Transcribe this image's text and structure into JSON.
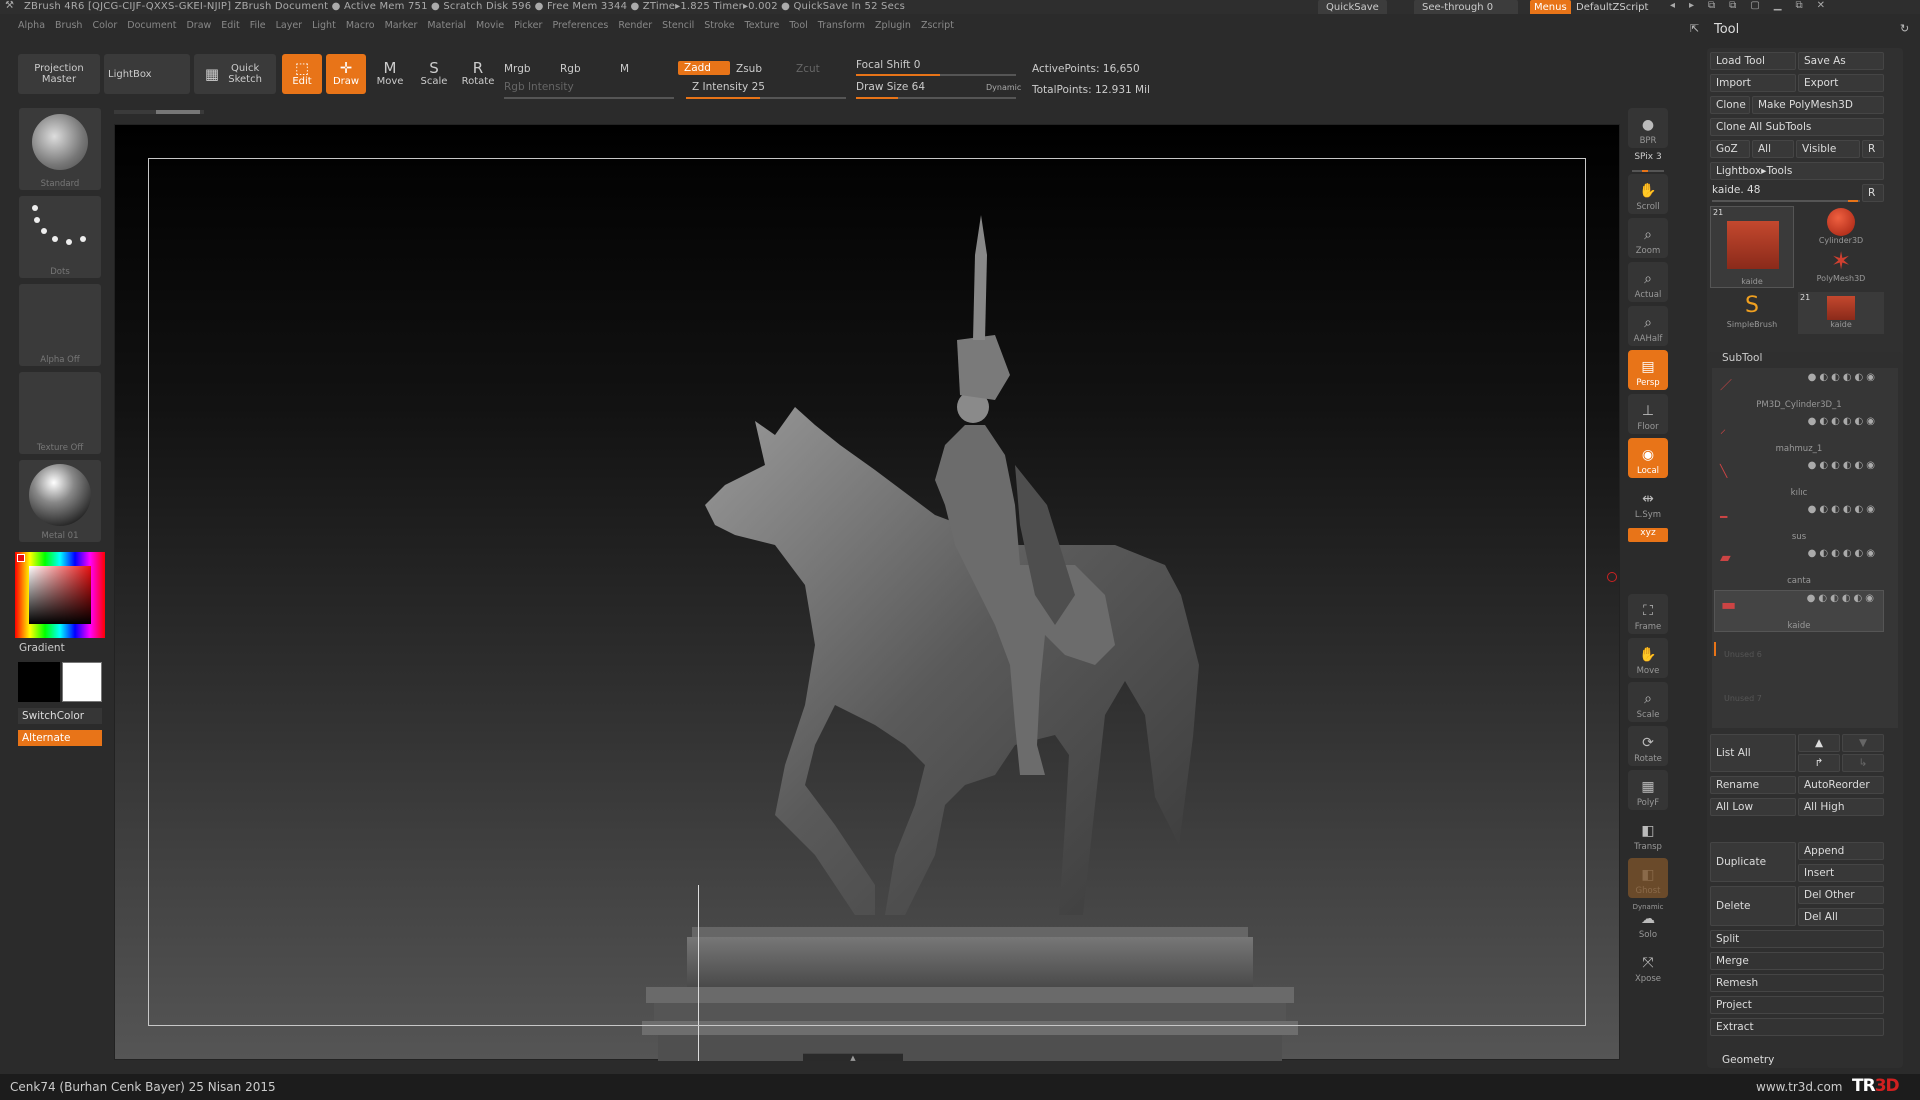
{
  "title": "ZBrush 4R6 [QJCG-CIJF-QXXS-GKEI-NJIP]   ZBrush Document    ● Active Mem 751  ● Scratch Disk 596  ● Free Mem 3344  ● ZTime▸1.825  Timer▸0.002  ● QuickSave In 52 Secs",
  "title_right": {
    "quicksave": "QuickSave",
    "see_through": "See-through  0",
    "menus": "Menus",
    "script": "DefaultZScript"
  },
  "menu": [
    "Alpha",
    "Brush",
    "Color",
    "Document",
    "Draw",
    "Edit",
    "File",
    "Layer",
    "Light",
    "Macro",
    "Marker",
    "Material",
    "Movie",
    "Picker",
    "Preferences",
    "Render",
    "Stencil",
    "Stroke",
    "Texture",
    "Tool",
    "Transform",
    "Zplugin",
    "Zscript"
  ],
  "toolbar": {
    "projection_master": "Projection Master",
    "lightbox": "LightBox",
    "quick_sketch": "Quick Sketch",
    "edit": "Edit",
    "draw": "Draw",
    "move": "Move",
    "scale": "Scale",
    "rotate": "Rotate",
    "mrgb": "Mrgb",
    "rgb": "Rgb",
    "m": "M",
    "rgb_intensity": "Rgb Intensity",
    "zadd": "Zadd",
    "zsub": "Zsub",
    "zcut": "Zcut",
    "z_intensity": "Z Intensity 25",
    "focal_shift": "Focal Shift 0",
    "draw_size": "Draw Size 64",
    "dynamic": "Dynamic",
    "active_points": "ActivePoints: 16,650",
    "total_points": "TotalPoints: 12.931  Mil"
  },
  "left": {
    "brush": "Standard",
    "stroke": "Dots",
    "alpha": "Alpha Off",
    "texture": "Texture Off",
    "material": "Metal 01",
    "gradient": "Gradient",
    "switch_color": "SwitchColor",
    "alternate": "Alternate"
  },
  "right_strip": [
    {
      "label": "BPR"
    },
    {
      "label": "SPix 3"
    },
    {
      "label": "Scroll"
    },
    {
      "label": "Zoom"
    },
    {
      "label": "Actual"
    },
    {
      "label": "AAHalf"
    },
    {
      "label": "Persp"
    },
    {
      "label": "Floor"
    },
    {
      "label": "Local"
    },
    {
      "label": "L.Sym"
    },
    {
      "label": "Frame"
    },
    {
      "label": "Move"
    },
    {
      "label": "Scale"
    },
    {
      "label": "Rotate"
    },
    {
      "label": "PolyF"
    },
    {
      "label": "Transp"
    },
    {
      "label": "Ghost"
    },
    {
      "label": "Dynamic"
    },
    {
      "label": "Solo"
    },
    {
      "label": "Xpose"
    }
  ],
  "tool": {
    "header": "Tool",
    "load_tool": "Load Tool",
    "save_as": "Save As",
    "import": "Import",
    "export": "Export",
    "clone": "Clone",
    "make_polymesh": "Make PolyMesh3D",
    "clone_all": "Clone All SubTools",
    "goz": "GoZ",
    "all": "All",
    "visible": "Visible",
    "r": "R",
    "lightbox_tools": "Lightbox▸Tools",
    "current": "kaide. 48",
    "thumbs": [
      {
        "name": "kaide",
        "count": "21"
      },
      {
        "name": "Cylinder3D"
      },
      {
        "name": "PolyMesh3D"
      },
      {
        "name": "SimpleBrush"
      },
      {
        "name": "kaide",
        "count": "21"
      }
    ],
    "subtool_header": "SubTool",
    "subtools": [
      "PM3D_Cylinder3D_1",
      "mahmuz_1",
      "kılıc",
      "sus",
      "canta",
      "kaide"
    ],
    "unused": [
      "Unused 6",
      "Unused 7"
    ],
    "list_all": "List All",
    "rename": "Rename",
    "auto_reorder": "AutoReorder",
    "all_low": "All Low",
    "all_high": "All High",
    "duplicate": "Duplicate",
    "append": "Append",
    "insert": "Insert",
    "delete": "Delete",
    "del_other": "Del Other",
    "del_all": "Del All",
    "split": "Split",
    "merge": "Merge",
    "remesh": "Remesh",
    "project": "Project",
    "extract": "Extract",
    "geometry": "Geometry"
  },
  "status": {
    "left": "Cenk74 (Burhan Cenk Bayer)  25 Nisan 2015",
    "right": "www.tr3d.com",
    "logo": "TR3D"
  }
}
